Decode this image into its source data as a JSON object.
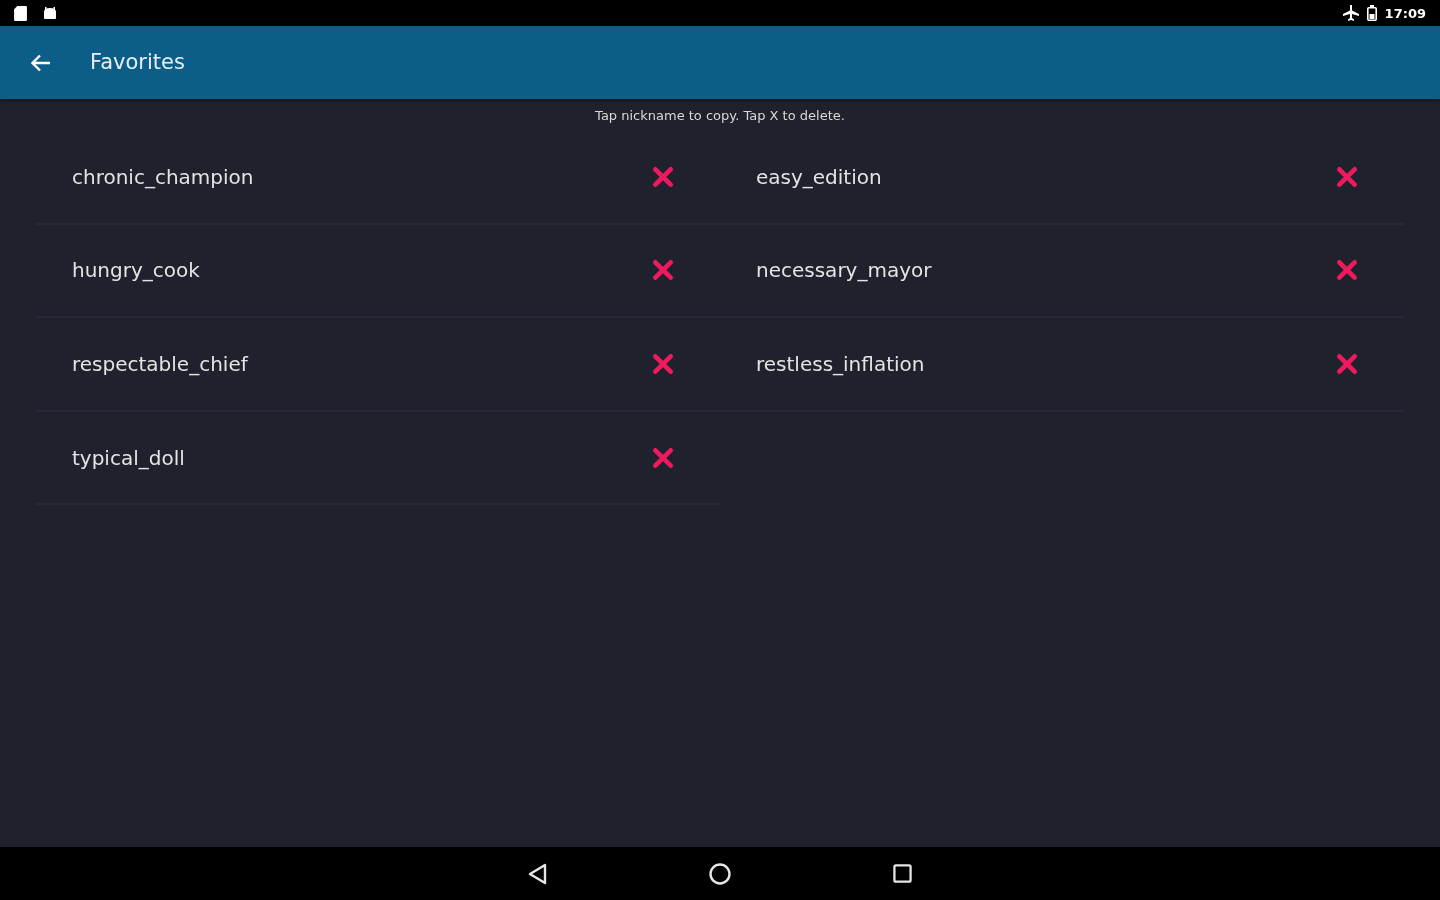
{
  "status_bar": {
    "time": "17:09"
  },
  "app_bar": {
    "title": "Favorites"
  },
  "hint": "Tap nickname to copy. Tap X to delete.",
  "favorites": [
    {
      "nickname": "chronic_champion"
    },
    {
      "nickname": "easy_edition"
    },
    {
      "nickname": "hungry_cook"
    },
    {
      "nickname": "necessary_mayor"
    },
    {
      "nickname": "respectable_chief"
    },
    {
      "nickname": "restless_inflation"
    },
    {
      "nickname": "typical_doll"
    }
  ]
}
